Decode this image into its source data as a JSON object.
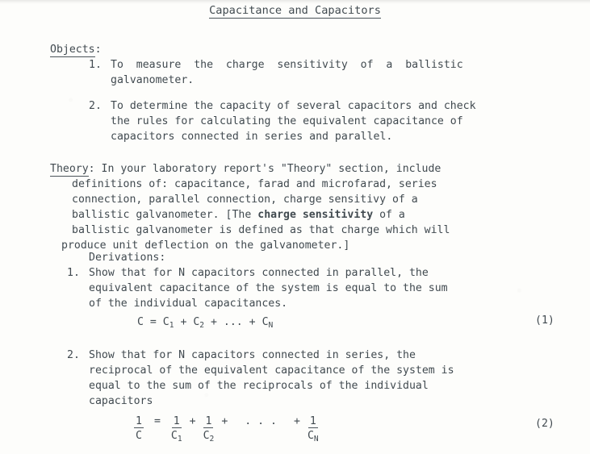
{
  "document": {
    "title": "Capacitance and Capacitors",
    "sections": {
      "objects": {
        "label": "Objects",
        "label_colon": ":",
        "items": [
          {
            "number": "1.",
            "lines": [
              "To  measure  the  charge  sensitivity  of  a  ballistic",
              "galvanometer."
            ]
          },
          {
            "number": "2.",
            "lines": [
              "To determine the capacity of several capacitors and check",
              "the rules for calculating the equivalent capacitance of",
              "capacitors connected in series and parallel."
            ]
          }
        ]
      },
      "theory": {
        "label": "Theory",
        "label_colon": ":",
        "lines": [
          " In your laboratory report's \"Theory\" section, include",
          "definitions of: capacitance, farad and microfarad, series",
          "connection, parallel connection, charge sensitivy of a",
          "ballistic galvanometer. [The ",
          "ballistic galvanometer is defined as that charge which will",
          "produce unit deflection on the galvanometer.]"
        ],
        "bold_phrase": "charge sensitivity",
        "line4_tail": " of a"
      },
      "derivations": {
        "label": "Derivations:",
        "items": [
          {
            "number": "1.",
            "lines": [
              "Show that for N capacitors connected in parallel, the",
              "equivalent capacitance of the system is equal to the sum",
              "of the individual capacitances."
            ]
          },
          {
            "number": "2.",
            "lines": [
              "Show that for N capacitors connected in series, the",
              "reciprocal of the equivalent capacitance of the system is",
              "equal to the sum of the reciprocals of the individual",
              "capacitors"
            ]
          }
        ]
      }
    },
    "equations": [
      {
        "id": "1",
        "number": "(1)",
        "plain": "C = C1 + C2 + ... + CN",
        "parts": {
          "lhs": "C",
          "eq": " = ",
          "t1_base": "C",
          "t1_sub": "1",
          "plus1": " + ",
          "t2_base": "C",
          "t2_sub": "2",
          "plus2": " + ",
          "dots": "...",
          "plus3": " + ",
          "t3_base": "C",
          "t3_sub": "N"
        }
      },
      {
        "id": "2",
        "number": "(2)",
        "plain": "1/C = 1/C1 + 1/C2 + ... + 1/CN",
        "parts": {
          "f0_num": "1",
          "f0_den": "C",
          "eq": "=",
          "f1_num": "1",
          "f1_den_base": "C",
          "f1_den_sub": "1",
          "plus1": "+",
          "f2_num": "1",
          "f2_den_base": "C",
          "f2_den_sub": "2",
          "plus2": "+",
          "dots": ". . .",
          "plus3": "+",
          "f3_num": "1",
          "f3_den_base": "C",
          "f3_den_sub": "N"
        }
      }
    ]
  },
  "colors": {
    "page_background": "#fdfdfb",
    "ink": "#414a50",
    "rule": "#4a5359"
  }
}
